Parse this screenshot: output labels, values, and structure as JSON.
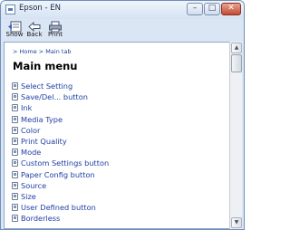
{
  "window": {
    "title": "Epson - EN",
    "controls": {
      "minimize": "–",
      "maximize": "□",
      "close": "✕"
    }
  },
  "toolbar": {
    "show_label": "Show",
    "back_label": "Back",
    "print_label": "Print"
  },
  "breadcrumb": {
    "home": "> Home",
    "current": "> Main tab"
  },
  "page_title": "Main menu",
  "menu": [
    "Select Setting",
    "Save/Del... button",
    "Ink",
    "Media Type",
    "Color",
    "Print Quality",
    "Mode",
    "Custom Settings button",
    "Paper Config button",
    "Source",
    "Size",
    "User Defined button",
    "Borderless"
  ],
  "scrollbar": {
    "up": "▲",
    "down": "▼"
  },
  "colors": {
    "link": "#1f3fa3",
    "title_bar": "#dbe6f4",
    "close": "#c34a31"
  }
}
